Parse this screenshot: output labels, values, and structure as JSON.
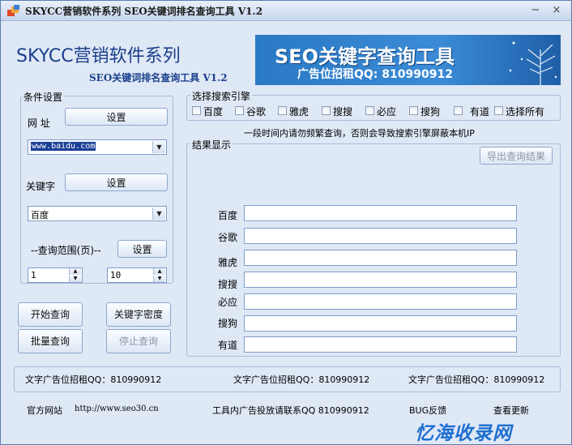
{
  "titlebar": {
    "title": "SKYCC营销软件系列 SEO关键词排名查询工具 V1.2",
    "minimize": "−",
    "close": "×"
  },
  "header": {
    "brand": "SKYCC营销软件系列",
    "subtitle": "SEO关键词排名查询工具 V1.2"
  },
  "banner": {
    "title": "SEO关键字查询工具",
    "ad": "广告位招租QQ: 810990912"
  },
  "conditions": {
    "group_label": "条件设置",
    "url_label": "网 址",
    "url_set_button": "设置",
    "url_value": "www.baidu.com",
    "keyword_label": "关键字",
    "keyword_set_button": "设置",
    "keyword_value": "百度",
    "range_label": "--查询范围(页)--",
    "range_set_button": "设置",
    "range_from": "1",
    "range_to": "10"
  },
  "actions": {
    "start": "开始查询",
    "density": "关键字密度",
    "batch": "批量查询",
    "stop": "停止查询"
  },
  "engines": {
    "group_label": "选择搜索引擎",
    "items": [
      "百度",
      "谷歌",
      "雅虎",
      "搜搜",
      "必应",
      "搜狗",
      "有道",
      "选择所有"
    ],
    "warning": "一段时间内请勿频繁查询，否则会导致搜索引擎屏蔽本机IP"
  },
  "results": {
    "group_label": "结果显示",
    "export_button": "导出查询结果",
    "rows": [
      "百度",
      "谷歌",
      "雅虎",
      "搜搜",
      "必应",
      "搜狗",
      "有道"
    ]
  },
  "ads": [
    "文字广告位招租QQ：810990912",
    "文字广告位招租QQ：810990912",
    "文字广告位招租QQ：810990912"
  ],
  "footer": {
    "site_label": "官方网站",
    "site_url": "http://www.seo30.cn",
    "contact": "工具内广告投放请联系QQ 810990912",
    "feedback": "BUG反馈",
    "update": "查看更新"
  },
  "watermark": "忆海收录网"
}
